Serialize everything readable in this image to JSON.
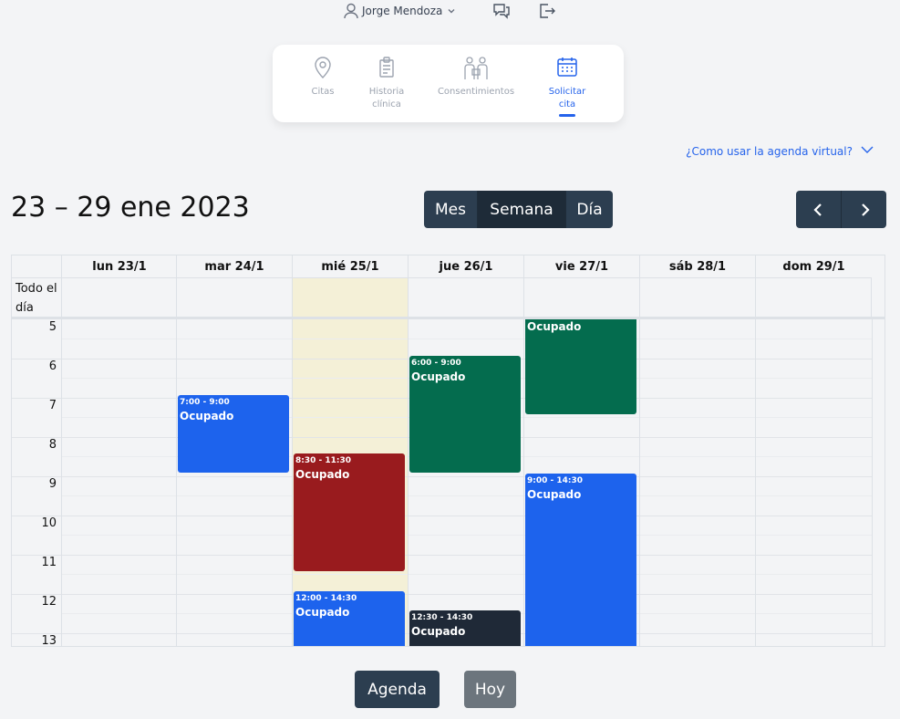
{
  "header": {
    "user_name": "Jorge Mendoza",
    "icons": [
      "user-icon",
      "chevron-down-icon",
      "chat-icon",
      "logout-icon"
    ]
  },
  "nav": {
    "items": [
      {
        "label": "Citas",
        "icon": "location-pin-icon",
        "active": false
      },
      {
        "label": "Historia clínica",
        "icon": "clipboard-icon",
        "active": false
      },
      {
        "label": "Consentimientos",
        "icon": "people-icon",
        "active": false
      },
      {
        "label": "Solicitar cita",
        "icon": "calendar-icon",
        "active": true
      }
    ]
  },
  "help_link": "¿Como usar la agenda virtual?",
  "calendar": {
    "date_range": "23 – 29 ene 2023",
    "views": [
      "Mes",
      "Semana",
      "Día"
    ],
    "active_view": "Semana",
    "days": [
      "lun 23/1",
      "mar 24/1",
      "mié 25/1",
      "jue 26/1",
      "vie 27/1",
      "sáb 28/1",
      "dom 29/1"
    ],
    "all_day_label": "Todo el día",
    "hours": [
      "5",
      "6",
      "7",
      "8",
      "9",
      "10",
      "11",
      "12",
      "13"
    ],
    "events": [
      {
        "day": 1,
        "time": "7:00 - 9:00",
        "title": "Ocupado",
        "color": "#1d63ed"
      },
      {
        "day": 2,
        "time": "8:30 - 11:30",
        "title": "Ocupado",
        "color": "#991b1e"
      },
      {
        "day": 2,
        "time": "12:00 - 14:30",
        "title": "Ocupado",
        "color": "#1d63ed"
      },
      {
        "day": 3,
        "time": "6:00 - 9:00",
        "title": "Ocupado",
        "color": "#046c4e"
      },
      {
        "day": 3,
        "time": "12:30 - 14:30",
        "title": "Ocupado",
        "color": "#1f2937"
      },
      {
        "day": 4,
        "time": "",
        "title": "Ocupado",
        "color": "#046c4e"
      },
      {
        "day": 4,
        "time": "9:00 - 14:30",
        "title": "Ocupado",
        "color": "#1d63ed"
      }
    ]
  },
  "footer": {
    "agenda_label": "Agenda",
    "today_label": "Hoy"
  },
  "colors": {
    "accent": "#2563eb",
    "dark_button": "#2c3e50",
    "today_highlight": "#f4f0d7"
  }
}
